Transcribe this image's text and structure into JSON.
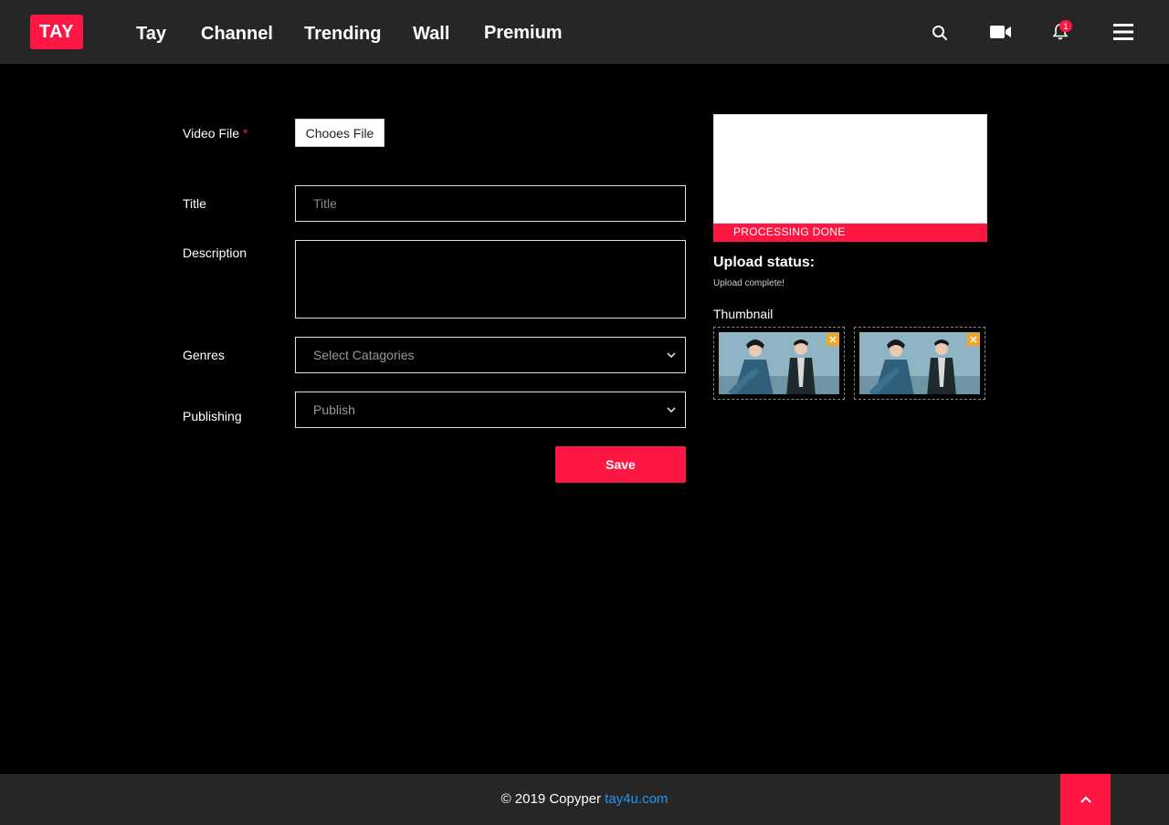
{
  "header": {
    "logo_text": "TAY",
    "nav": [
      "Tay",
      "Channel",
      "Trending",
      "Wall",
      "Premium"
    ],
    "notification_count": "1"
  },
  "form": {
    "video_file_label": "Video File",
    "required_mark": "*",
    "file_button_label": "Chooes File",
    "title_label": "Title",
    "title_placeholder": "Title",
    "description_label": "Description",
    "genres_label": "Genres",
    "genres_value": "Select Catagories",
    "publishing_label": "Publishing",
    "publishing_value": "Publish",
    "save_label": "Save"
  },
  "upload": {
    "progress_label": "PROCESSING DONE",
    "progress_percent": 100,
    "status_title": "Upload status:",
    "status_text": "Upload complete!",
    "thumbnail_label": "Thumbnail"
  },
  "footer": {
    "copyright": "© 2019 Copyper",
    "link_text": "tay4u.com"
  },
  "colors": {
    "accent": "#ff1744",
    "header_bg": "#262626",
    "link": "#2196f3"
  }
}
